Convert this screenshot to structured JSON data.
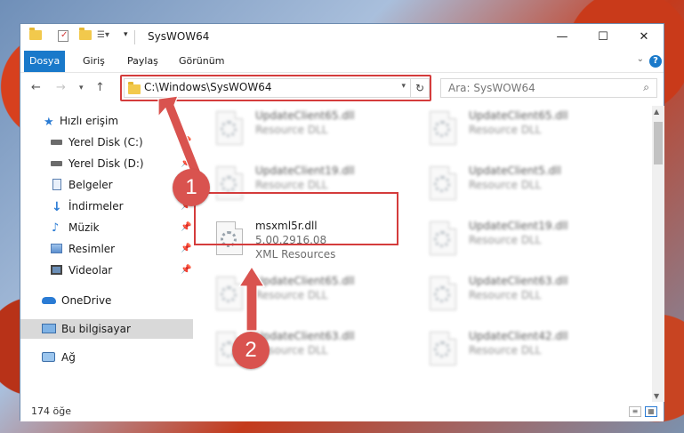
{
  "window": {
    "title": "SysWOW64",
    "controls": {
      "minimize": "—",
      "maximize": "☐",
      "close": "✕"
    }
  },
  "ribbon": {
    "tabs": [
      {
        "label": "Dosya",
        "active": true
      },
      {
        "label": "Giriş",
        "active": false
      },
      {
        "label": "Paylaş",
        "active": false
      },
      {
        "label": "Görünüm",
        "active": false
      }
    ],
    "help": "?"
  },
  "address": {
    "path": "C:\\Windows\\SysWOW64"
  },
  "search": {
    "placeholder": "Ara: SysWOW64"
  },
  "navigation": {
    "items": [
      {
        "label": "Hızlı erişim",
        "icon": "star-icon",
        "pinned": false
      },
      {
        "label": "Yerel Disk (C:)",
        "icon": "drive-icon",
        "pinned": true
      },
      {
        "label": "Yerel Disk (D:)",
        "icon": "drive-icon",
        "pinned": true
      },
      {
        "label": "Belgeler",
        "icon": "documents-icon",
        "pinned": true
      },
      {
        "label": "İndirmeler",
        "icon": "download-icon",
        "pinned": true
      },
      {
        "label": "Müzik",
        "icon": "music-icon",
        "pinned": true
      },
      {
        "label": "Resimler",
        "icon": "pictures-icon",
        "pinned": true
      },
      {
        "label": "Videolar",
        "icon": "video-icon",
        "pinned": true
      },
      {
        "label": "OneDrive",
        "icon": "cloud-icon",
        "pinned": false
      },
      {
        "label": "Bu bilgisayar",
        "icon": "computer-icon",
        "pinned": false,
        "selected": true
      },
      {
        "label": "Ağ",
        "icon": "network-icon",
        "pinned": false
      }
    ]
  },
  "files": [
    {
      "name": "UpdateClient65.dll",
      "line2": "Resource DLL",
      "blurred": true
    },
    {
      "name": "UpdateClient65.dll",
      "line2": "Resource DLL",
      "blurred": true
    },
    {
      "name": "UpdateClient19.dll",
      "line2": "Resource DLL",
      "blurred": true
    },
    {
      "name": "UpdateClient5.dll",
      "line2": "Resource DLL",
      "blurred": true
    },
    {
      "name": "msxml5r.dll",
      "line2": "5.00.2916.08",
      "line3": "XML Resources",
      "blurred": false
    },
    {
      "name": "UpdateClient19.dll",
      "line2": "Resource DLL",
      "blurred": true
    },
    {
      "name": "UpdateClient65.dll",
      "line2": "Resource DLL",
      "blurred": true
    },
    {
      "name": "UpdateClient63.dll",
      "line2": "Resource DLL",
      "blurred": true
    },
    {
      "name": "UpdateClient63.dll",
      "line2": "Resource DLL",
      "blurred": true
    },
    {
      "name": "UpdateClient42.dll",
      "line2": "Resource DLL",
      "blurred": true
    }
  ],
  "status": {
    "count": "174 öğe"
  },
  "callouts": [
    "1",
    "2"
  ],
  "colors": {
    "accent": "#1979ca",
    "highlight": "#d43c3c",
    "callout": "#d9534f"
  }
}
